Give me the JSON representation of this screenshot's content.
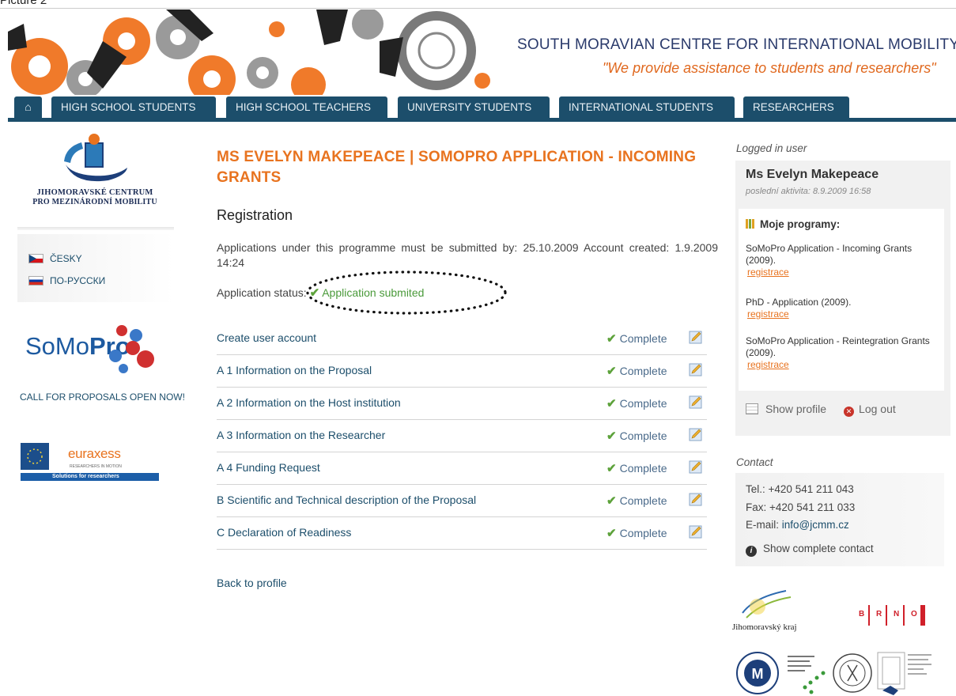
{
  "page_caption": "Picture 2",
  "header": {
    "site_title": "SOUTH MORAVIAN CENTRE FOR INTERNATIONAL MOBILITY",
    "slogan": "\"We provide assistance to students and researchers\"",
    "home_icon": "home-icon",
    "nav_tabs": [
      {
        "label": "HIGH SCHOOL STUDENTS"
      },
      {
        "label": "HIGH SCHOOL TEACHERS"
      },
      {
        "label": "UNIVERSITY STUDENTS"
      },
      {
        "label": "INTERNATIONAL STUDENTS"
      },
      {
        "label": "RESEARCHERS"
      }
    ]
  },
  "left": {
    "logo_line1": "JIHOMORAVSKÉ CENTRUM",
    "logo_line2": "PRO MEZINÁRODNÍ MOBILITU",
    "languages": [
      {
        "label": "ČESKY",
        "flag": "czech-flag-icon"
      },
      {
        "label": "ПО-РУССКИ",
        "flag": "russian-flag-icon"
      }
    ],
    "somopro_text_a": "SoMo",
    "somopro_text_b": "Pro",
    "call_for_proposals": "CALL FOR PROPOSALS OPEN NOW!",
    "euraxess_text": "euraxess",
    "euraxess_sub": "RESEARCHERS IN MOTION",
    "euraxess_banner": "Solutions for researchers"
  },
  "main": {
    "title": "MS EVELYN MAKEPEACE | SOMOPRO APPLICATION - INCOMING GRANTS",
    "section_title": "Registration",
    "submit_info": "Applications under this programme must be submitted by: 25.10.2009    Account created: 1.9.2009  14:24",
    "status_label": "Application status:",
    "status_value": "Application submited",
    "steps": [
      {
        "name": "Create user account",
        "status": "Complete"
      },
      {
        "name": "A 1 Information on the Proposal",
        "status": "Complete"
      },
      {
        "name": "A 2 Information on the Host institution",
        "status": "Complete"
      },
      {
        "name": "A 3 Information on the Researcher",
        "status": "Complete"
      },
      {
        "name": "A 4 Funding Request",
        "status": "Complete"
      },
      {
        "name": "B Scientific and Technical description of the Proposal",
        "status": "Complete"
      },
      {
        "name": "C Declaration of Readiness",
        "status": "Complete"
      }
    ],
    "back_link": "Back to profile"
  },
  "right": {
    "logged_label": "Logged in user",
    "user_name": "Ms Evelyn Makepeace",
    "last_activity": "poslední aktivita: 8.9.2009  16:58",
    "programs_title": "Moje programy:",
    "programs": [
      {
        "name": "SoMoPro Application - Incoming Grants (2009).",
        "link": "registrace"
      },
      {
        "name": "PhD - Application (2009).",
        "link": "registrace"
      },
      {
        "name": "SoMoPro Application - Reintegration Grants (2009).",
        "link": "registrace"
      }
    ],
    "show_profile": "Show profile",
    "log_out": "Log out",
    "contact_label": "Contact",
    "tel_label": "Tel.:",
    "tel": "+420 541 211 043",
    "fax_label": "Fax:",
    "fax": "+420 541 211 033",
    "email_label": "E-mail:",
    "email": "info@jcmm.cz",
    "show_contact": "Show complete contact",
    "partner_jmk": "Jihomoravský kraj",
    "partner_brno": [
      "B",
      "R",
      "N",
      "O"
    ]
  },
  "colors": {
    "orange": "#e8731f",
    "navy": "#1c4e6b",
    "green": "#4a9a3a"
  }
}
